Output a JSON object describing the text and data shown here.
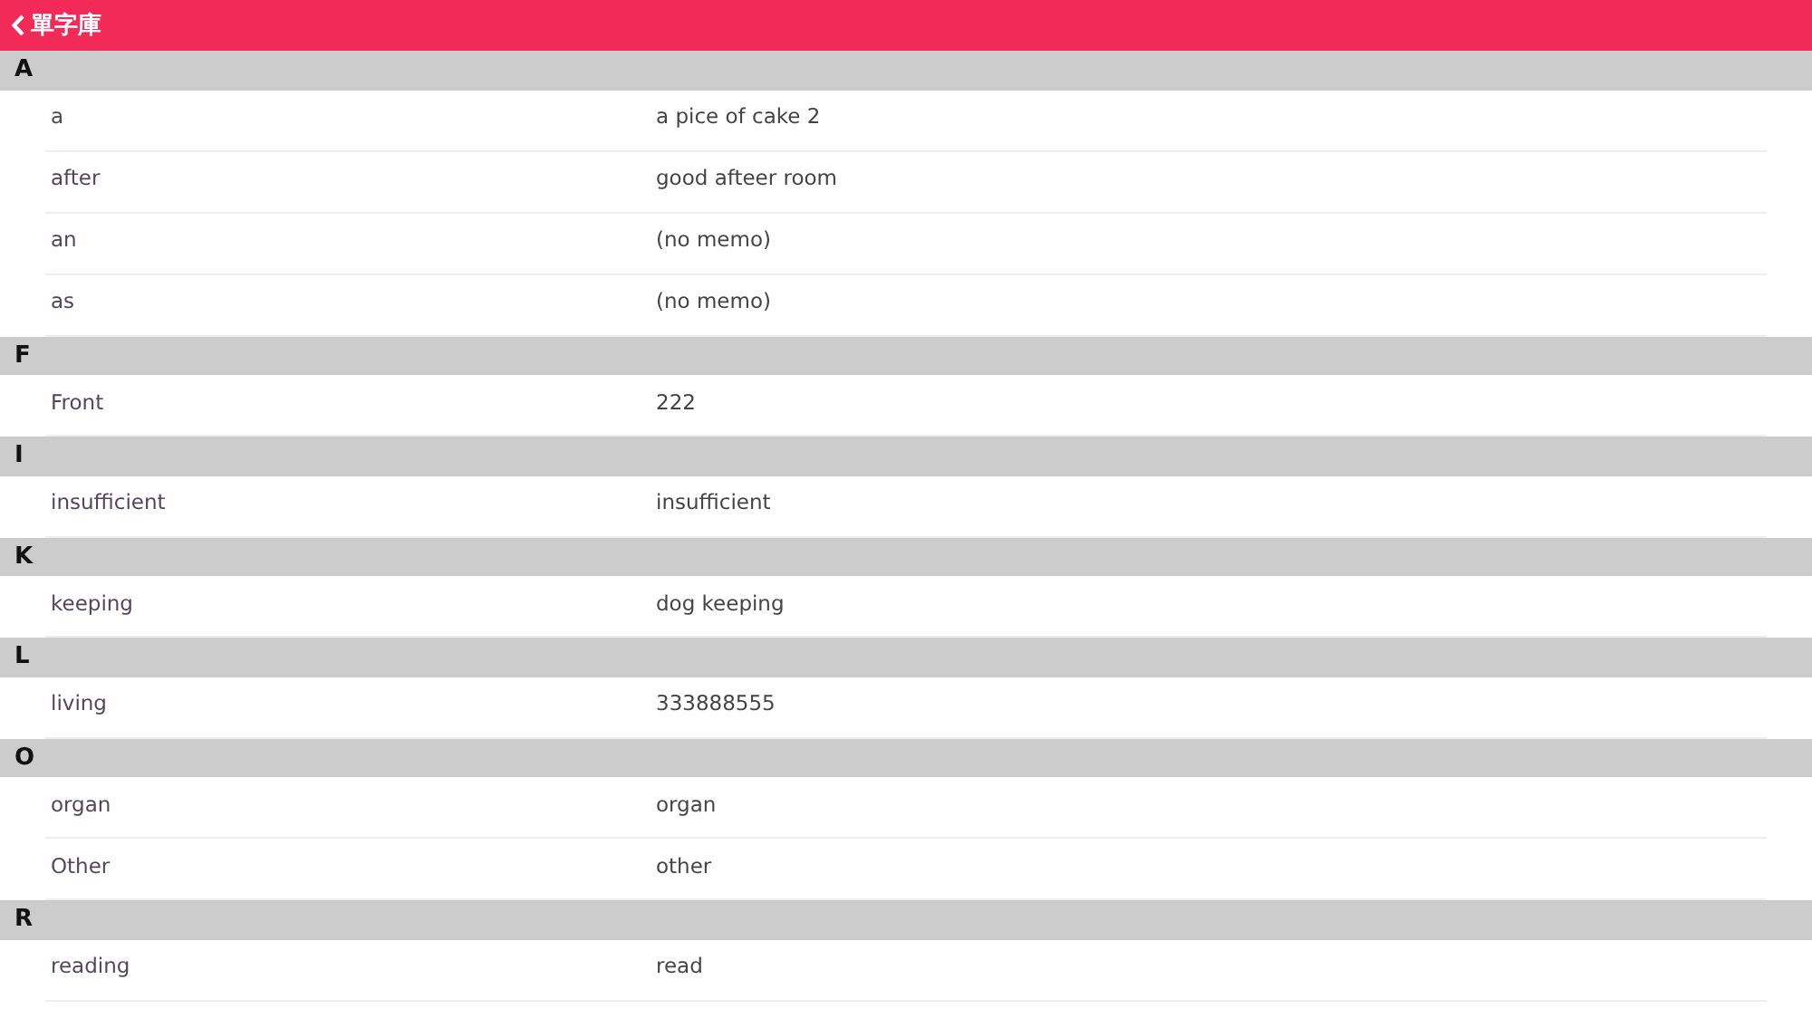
{
  "header": {
    "title": "單字庫"
  },
  "sections": [
    {
      "letter": "A",
      "entries": [
        {
          "word": "a",
          "memo": "a pice of cake 2"
        },
        {
          "word": "after",
          "memo": "good afteer room"
        },
        {
          "word": "an",
          "memo": "(no memo)"
        },
        {
          "word": "as",
          "memo": "(no memo)"
        }
      ]
    },
    {
      "letter": "F",
      "entries": [
        {
          "word": "Front",
          "memo": "222"
        }
      ]
    },
    {
      "letter": "I",
      "entries": [
        {
          "word": "insufficient",
          "memo": "insufficient"
        }
      ]
    },
    {
      "letter": "K",
      "entries": [
        {
          "word": "keeping",
          "memo": "dog keeping"
        }
      ]
    },
    {
      "letter": "L",
      "entries": [
        {
          "word": "living",
          "memo": "333888555"
        }
      ]
    },
    {
      "letter": "O",
      "entries": [
        {
          "word": "organ",
          "memo": "organ"
        },
        {
          "word": "Other",
          "memo": "other"
        }
      ]
    },
    {
      "letter": "R",
      "entries": [
        {
          "word": "reading",
          "memo": "read"
        }
      ]
    }
  ]
}
